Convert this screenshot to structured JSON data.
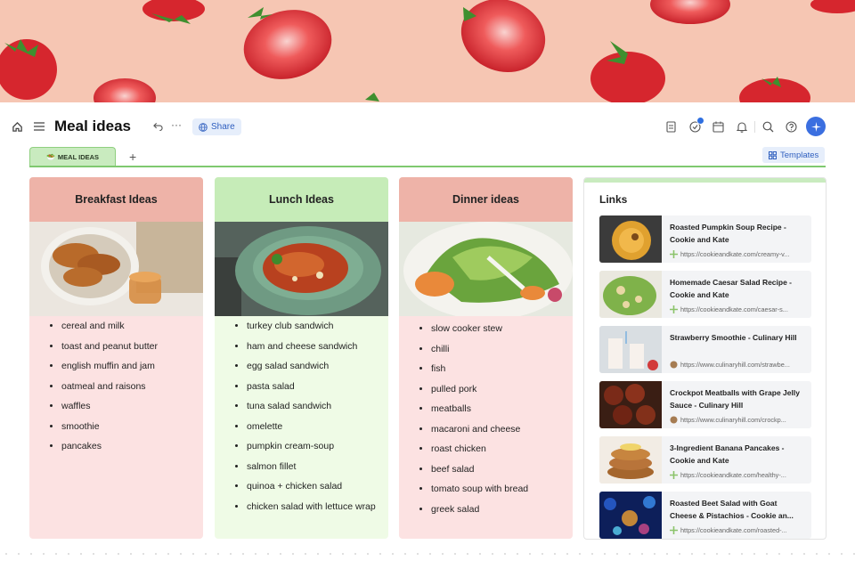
{
  "page": {
    "title": "Meal ideas",
    "share_label": "Share",
    "templates_label": "Templates",
    "tab_label": "MEAL IDEAS",
    "add_tab_glyph": "+",
    "colors": {
      "banner": "#f6c6b3",
      "breakfast_head": "#eeb3a8",
      "breakfast_body": "#fce2e2",
      "lunch_head": "#c6ecb8",
      "lunch_body": "#effbe6",
      "dinner_head": "#eeb3a8",
      "dinner_body": "#fce2e2",
      "accent": "#3b6fe0"
    },
    "icons": [
      "home-icon",
      "menu-icon",
      "undo-icon",
      "more-icon",
      "globe-icon",
      "doc-icon",
      "check-circle-icon",
      "calendar-icon",
      "bell-icon",
      "search-icon",
      "help-icon",
      "spark-icon",
      "templates-icon",
      "plus-icon"
    ]
  },
  "columns": [
    {
      "title": "Breakfast Ideas",
      "items": [
        "cereal and milk",
        "toast and peanut butter",
        "english muffin and jam",
        "oatmeal and raisons",
        "waffles",
        "smoothie",
        "pancakes"
      ]
    },
    {
      "title": "Lunch Ideas",
      "items": [
        "turkey club sandwich",
        "ham and cheese sandwich",
        "egg salad sandwich",
        "pasta salad",
        "tuna salad sandwich",
        "omelette",
        "pumpkin cream-soup",
        "salmon fillet",
        "quinoa + chicken salad",
        "chicken salad with lettuce wrap"
      ]
    },
    {
      "title": "Dinner ideas",
      "items": [
        "slow cooker stew",
        "chilli",
        "fish",
        "pulled pork",
        "meatballs",
        "macaroni and cheese",
        "roast chicken",
        "beef salad",
        "tomato soup with bread",
        "greek salad"
      ]
    }
  ],
  "links": {
    "title": "Links",
    "items": [
      {
        "title": "Roasted Pumpkin Soup Recipe - Cookie and Kate",
        "url": "https://cookieandkate.com/creamy-v..."
      },
      {
        "title": "Homemade Caesar Salad Recipe - Cookie and Kate",
        "url": "https://cookieandkate.com/caesar-s..."
      },
      {
        "title": "Strawberry Smoothie - Culinary Hill",
        "url": "https://www.culinaryhill.com/strawbe..."
      },
      {
        "title": "Crockpot Meatballs with Grape Jelly Sauce - Culinary Hill",
        "url": "https://www.culinaryhill.com/crockp..."
      },
      {
        "title": "3-Ingredient Banana Pancakes - Cookie and Kate",
        "url": "https://cookieandkate.com/healthy-..."
      },
      {
        "title": "Roasted Beet Salad with Goat Cheese & Pistachios - Cookie an...",
        "url": "https://cookieandkate.com/roasted-..."
      }
    ]
  }
}
